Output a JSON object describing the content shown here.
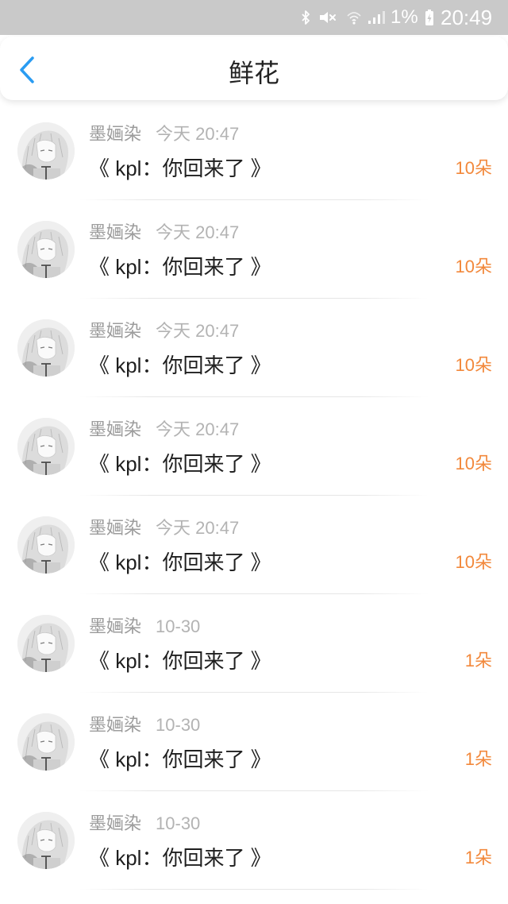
{
  "status_bar": {
    "battery_percent": "1%",
    "time": "20:49",
    "icons": [
      "bluetooth-icon",
      "mute-icon",
      "wifi-icon",
      "signal-icon",
      "battery-charging-icon"
    ]
  },
  "header": {
    "title": "鲜花",
    "back_icon": "chevron-left-icon"
  },
  "theme": {
    "accent": "#2a9cf2",
    "count": "#f2883b",
    "status_bar": "#c9c9c9",
    "name": "#9c9c9c",
    "time": "#b3b3b3",
    "title": "#1f1f1f"
  },
  "records": [
    {
      "name": "墨婳染",
      "time": "今天 20:47",
      "title": "《 kpl：你回来了 》",
      "count": "10朵"
    },
    {
      "name": "墨婳染",
      "time": "今天 20:47",
      "title": "《 kpl：你回来了 》",
      "count": "10朵"
    },
    {
      "name": "墨婳染",
      "time": "今天 20:47",
      "title": "《 kpl：你回来了 》",
      "count": "10朵"
    },
    {
      "name": "墨婳染",
      "time": "今天 20:47",
      "title": "《 kpl：你回来了 》",
      "count": "10朵"
    },
    {
      "name": "墨婳染",
      "time": "今天 20:47",
      "title": "《 kpl：你回来了 》",
      "count": "10朵"
    },
    {
      "name": "墨婳染",
      "time": "10-30",
      "title": "《 kpl：你回来了 》",
      "count": "1朵"
    },
    {
      "name": "墨婳染",
      "time": "10-30",
      "title": "《 kpl：你回来了 》",
      "count": "1朵"
    },
    {
      "name": "墨婳染",
      "time": "10-30",
      "title": "《 kpl：你回来了 》",
      "count": "1朵"
    }
  ]
}
